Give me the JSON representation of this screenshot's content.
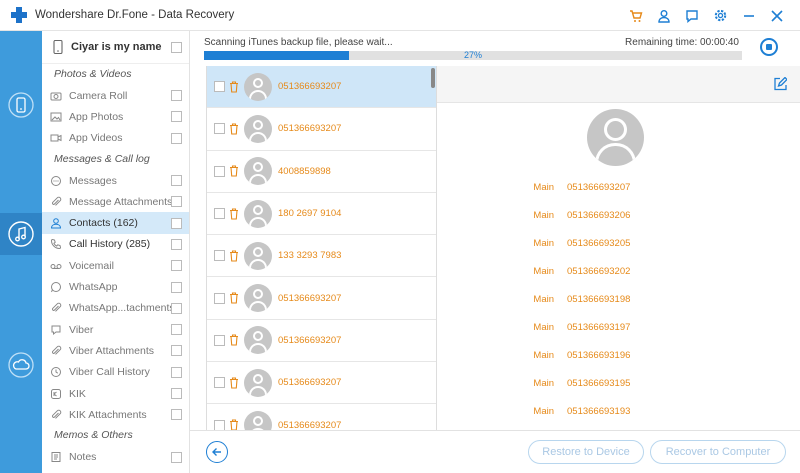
{
  "app": {
    "title": "Wondershare Dr.Fone - Data Recovery"
  },
  "titlebar": {
    "icons": [
      "cart-icon",
      "user-icon",
      "feedback-icon",
      "settings-icon",
      "minimize-icon",
      "close-icon"
    ]
  },
  "colors": {
    "accent": "#1e7fd4",
    "rail": "#3e9bdc",
    "number": "#e68a1a",
    "selected": "#cfe6f8"
  },
  "rail": {
    "icons": [
      "device-recovery-icon",
      "itunes-recovery-icon",
      "icloud-recovery-icon"
    ],
    "active": "itunes-recovery-icon"
  },
  "sidebar": {
    "device_name": "Ciyar is my name",
    "sections": [
      {
        "title": "Photos & Videos",
        "items": [
          {
            "label": "Camera Roll",
            "icon": "camera-icon"
          },
          {
            "label": "App Photos",
            "icon": "image-icon"
          },
          {
            "label": "App Videos",
            "icon": "video-icon"
          }
        ]
      },
      {
        "title": "Messages & Call log",
        "items": [
          {
            "label": "Messages",
            "icon": "message-icon"
          },
          {
            "label": "Message Attachments",
            "icon": "attachment-icon"
          },
          {
            "label": "Contacts (162)",
            "icon": "contact-icon",
            "active": true
          },
          {
            "label": "Call History (285)",
            "icon": "phone-icon"
          },
          {
            "label": "Voicemail",
            "icon": "voicemail-icon"
          },
          {
            "label": "WhatsApp",
            "icon": "whatsapp-icon"
          },
          {
            "label": "WhatsApp...tachments",
            "icon": "attachment-icon"
          },
          {
            "label": "Viber",
            "icon": "viber-icon"
          },
          {
            "label": "Viber Attachments",
            "icon": "attachment-icon"
          },
          {
            "label": "Viber Call History",
            "icon": "history-icon"
          },
          {
            "label": "KIK",
            "icon": "kik-icon"
          },
          {
            "label": "KIK Attachments",
            "icon": "attachment-icon"
          }
        ]
      },
      {
        "title": "Memos & Others",
        "items": [
          {
            "label": "Notes",
            "icon": "notes-icon"
          }
        ]
      }
    ]
  },
  "progress": {
    "status": "Scanning iTunes backup file, please wait...",
    "remaining": "Remaining time: 00:00:40",
    "percent_text": "27%",
    "percent": 27
  },
  "contacts": [
    {
      "number": "051366693207",
      "selected": true
    },
    {
      "number": "051366693207"
    },
    {
      "number": "4008859898"
    },
    {
      "number": "180 2697 9104"
    },
    {
      "number": "133 3293 7983"
    },
    {
      "number": "051366693207"
    },
    {
      "number": "051366693207"
    },
    {
      "number": "051366693207"
    },
    {
      "number": "051366693207"
    }
  ],
  "detail": {
    "phones": [
      {
        "label": "Main",
        "number": "051366693207"
      },
      {
        "label": "Main",
        "number": "051366693206"
      },
      {
        "label": "Main",
        "number": "051366693205"
      },
      {
        "label": "Main",
        "number": "051366693202"
      },
      {
        "label": "Main",
        "number": "051366693198"
      },
      {
        "label": "Main",
        "number": "051366693197"
      },
      {
        "label": "Main",
        "number": "051366693196"
      },
      {
        "label": "Main",
        "number": "051366693195"
      },
      {
        "label": "Main",
        "number": "051366693193"
      }
    ]
  },
  "footer": {
    "restore_label": "Restore to Device",
    "recover_label": "Recover to Computer"
  }
}
